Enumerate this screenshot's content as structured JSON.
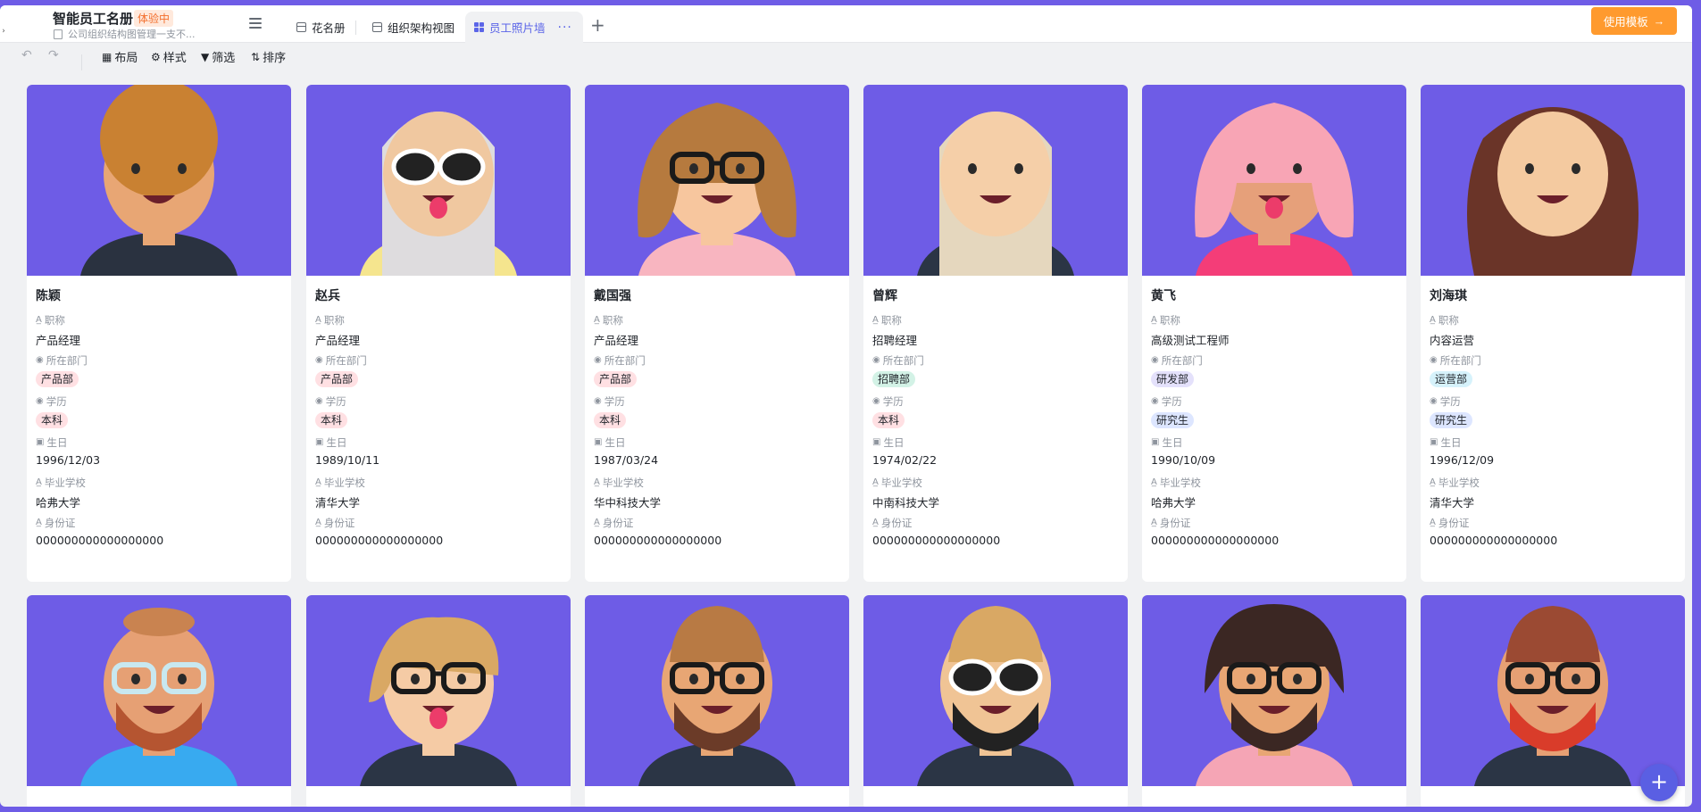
{
  "app": {
    "title": "智能员工名册",
    "badge": "体验中",
    "subtitle": "公司组织结构图管理一支不..."
  },
  "tabs": [
    {
      "label": "花名册",
      "icon": "grid-icon"
    },
    {
      "label": "组织架构视图",
      "icon": "grid-icon"
    },
    {
      "label": "员工照片墙",
      "icon": "apps-icon",
      "active": true
    }
  ],
  "more_label": "···",
  "add_tab_label": "+",
  "use_template_label": "使用模板",
  "toolbar": {
    "layout": "布局",
    "style": "样式",
    "filter": "筛选",
    "sort": "排序"
  },
  "field_labels": {
    "title": "职称",
    "dept": "所在部门",
    "edu": "学历",
    "birth": "生日",
    "school": "毕业学校",
    "id": "身份证"
  },
  "colors": {
    "accent": "#5b65e8",
    "card_bg": "#6e5ce6",
    "tag_product": "#ffe0e3",
    "tag_recruit": "#d3f2e6",
    "tag_rnd": "#e4e1fb",
    "tag_ops": "#d6f2fb",
    "tag_bachelor": "#ffe0e3",
    "tag_master": "#dde6ff"
  },
  "employees": [
    {
      "name": "陈颖",
      "title": "产品经理",
      "dept": "产品部",
      "edu": "本科",
      "birth": "1996/12/03",
      "school": "哈弗大学",
      "id": "000000000000000000"
    },
    {
      "name": "赵兵",
      "title": "产品经理",
      "dept": "产品部",
      "edu": "本科",
      "birth": "1989/10/11",
      "school": "清华大学",
      "id": "000000000000000000"
    },
    {
      "name": "戴国强",
      "title": "产品经理",
      "dept": "产品部",
      "edu": "本科",
      "birth": "1987/03/24",
      "school": "华中科技大学",
      "id": "000000000000000000"
    },
    {
      "name": "曾辉",
      "title": "招聘经理",
      "dept": "招聘部",
      "edu": "本科",
      "birth": "1974/02/22",
      "school": "中南科技大学",
      "id": "000000000000000000"
    },
    {
      "name": "黄飞",
      "title": "高级测试工程师",
      "dept": "研发部",
      "edu": "研究生",
      "birth": "1990/10/09",
      "school": "哈弗大学",
      "id": "000000000000000000"
    },
    {
      "name": "刘海琪",
      "title": "内容运营",
      "dept": "运营部",
      "edu": "研究生",
      "birth": "1996/12/09",
      "school": "清华大学",
      "id": "000000000000000000"
    }
  ]
}
